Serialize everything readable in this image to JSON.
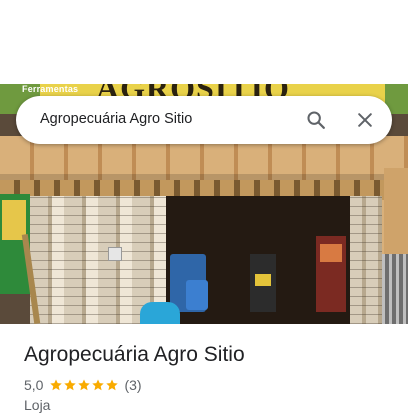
{
  "photo": {
    "sign_small_text": "Ferramentas",
    "sign_big_text": "AGROSITIO"
  },
  "search": {
    "query": "Agropecuária Agro Sitio",
    "search_icon": "search-icon",
    "close_icon": "close-icon"
  },
  "place": {
    "name": "Agropecuária Agro Sitio",
    "rating": "5,0",
    "stars_filled": 5,
    "reviews": "(3)",
    "category": "Loja"
  },
  "colors": {
    "star": "#F9AB00",
    "text_primary": "#202124",
    "text_secondary": "#5F6368"
  }
}
